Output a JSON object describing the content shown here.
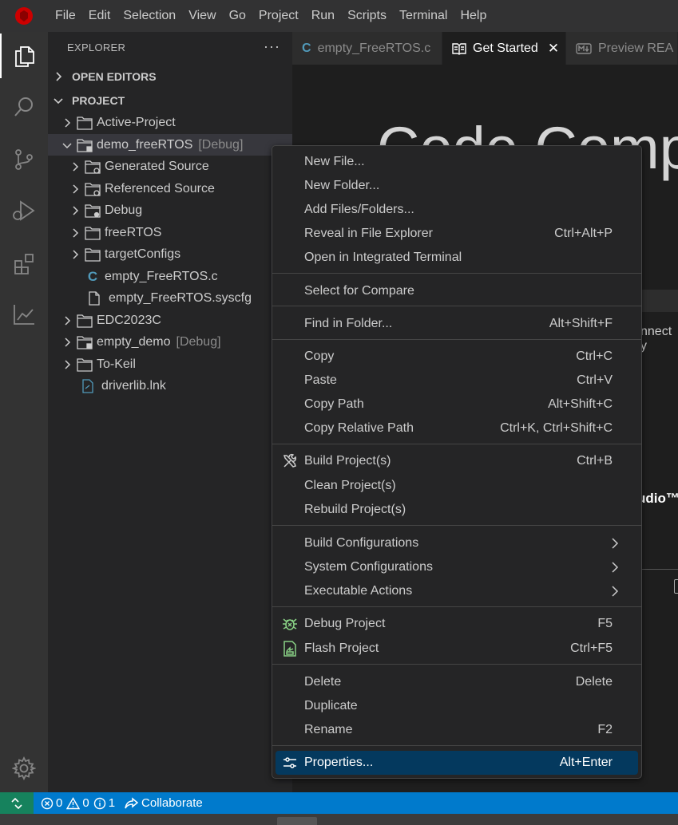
{
  "menubar": {
    "items": [
      "File",
      "Edit",
      "Selection",
      "View",
      "Go",
      "Project",
      "Run",
      "Scripts",
      "Terminal",
      "Help"
    ]
  },
  "sidebar": {
    "title": "EXPLORER",
    "more": "···",
    "open_editors": "OPEN EDITORS",
    "project": "PROJECT",
    "tree": [
      {
        "label": "Active-Project"
      },
      {
        "label": "demo_freeRTOS",
        "tag": "[Debug]"
      },
      {
        "label": "Generated Source"
      },
      {
        "label": "Referenced Source"
      },
      {
        "label": "Debug"
      },
      {
        "label": "freeRTOS"
      },
      {
        "label": "targetConfigs"
      },
      {
        "label": "empty_FreeRTOS.c"
      },
      {
        "label": "empty_FreeRTOS.syscfg"
      },
      {
        "label": "EDC2023C"
      },
      {
        "label": "empty_demo",
        "tag": "[Debug]"
      },
      {
        "label": "To-Keil"
      },
      {
        "label": "driverlib.lnk"
      }
    ]
  },
  "tabs": [
    {
      "label": "empty_FreeRTOS.c"
    },
    {
      "label": "Get Started",
      "close": "✕"
    },
    {
      "label": "Preview REA"
    }
  ],
  "editor": {
    "title_partial": "Code Compos",
    "peek_text_1": "nnect y",
    "peek_text_2": "udio™"
  },
  "context_menu": {
    "items": [
      {
        "label": "New File...",
        "shortcut": ""
      },
      {
        "label": "New Folder...",
        "shortcut": ""
      },
      {
        "label": "Add Files/Folders...",
        "shortcut": ""
      },
      {
        "label": "Reveal in File Explorer",
        "shortcut": "Ctrl+Alt+P"
      },
      {
        "label": "Open in Integrated Terminal",
        "shortcut": ""
      },
      {
        "label": "Select for Compare",
        "shortcut": ""
      },
      {
        "label": "Find in Folder...",
        "shortcut": "Alt+Shift+F"
      },
      {
        "label": "Copy",
        "shortcut": "Ctrl+C"
      },
      {
        "label": "Paste",
        "shortcut": "Ctrl+V"
      },
      {
        "label": "Copy Path",
        "shortcut": "Alt+Shift+C"
      },
      {
        "label": "Copy Relative Path",
        "shortcut": "Ctrl+K, Ctrl+Shift+C"
      },
      {
        "label": "Build Project(s)",
        "shortcut": "Ctrl+B",
        "icon": "tools-icon"
      },
      {
        "label": "Clean Project(s)",
        "shortcut": ""
      },
      {
        "label": "Rebuild Project(s)",
        "shortcut": ""
      },
      {
        "label": "Build Configurations",
        "shortcut": "",
        "submenu": true
      },
      {
        "label": "System Configurations",
        "shortcut": "",
        "submenu": true
      },
      {
        "label": "Executable Actions",
        "shortcut": "",
        "submenu": true
      },
      {
        "label": "Debug Project",
        "shortcut": "F5",
        "icon": "debug-bug-icon"
      },
      {
        "label": "Flash Project",
        "shortcut": "Ctrl+F5",
        "icon": "flash-icon"
      },
      {
        "label": "Delete",
        "shortcut": "Delete"
      },
      {
        "label": "Duplicate",
        "shortcut": ""
      },
      {
        "label": "Rename",
        "shortcut": "F2"
      },
      {
        "label": "Properties...",
        "shortcut": "Alt+Enter",
        "icon": "settings-sliders-icon",
        "highlighted": true
      }
    ]
  },
  "statusbar": {
    "errors": "0",
    "warnings": "0",
    "info": "1",
    "collaborate": "Collaborate"
  },
  "colors": {
    "accent": "#007acc",
    "menu_highlight": "#04395e",
    "remote": "#16825d",
    "ccs_logo": "#cc0000",
    "icon_green": "#89d185",
    "c_file_icon": "#519aba"
  }
}
